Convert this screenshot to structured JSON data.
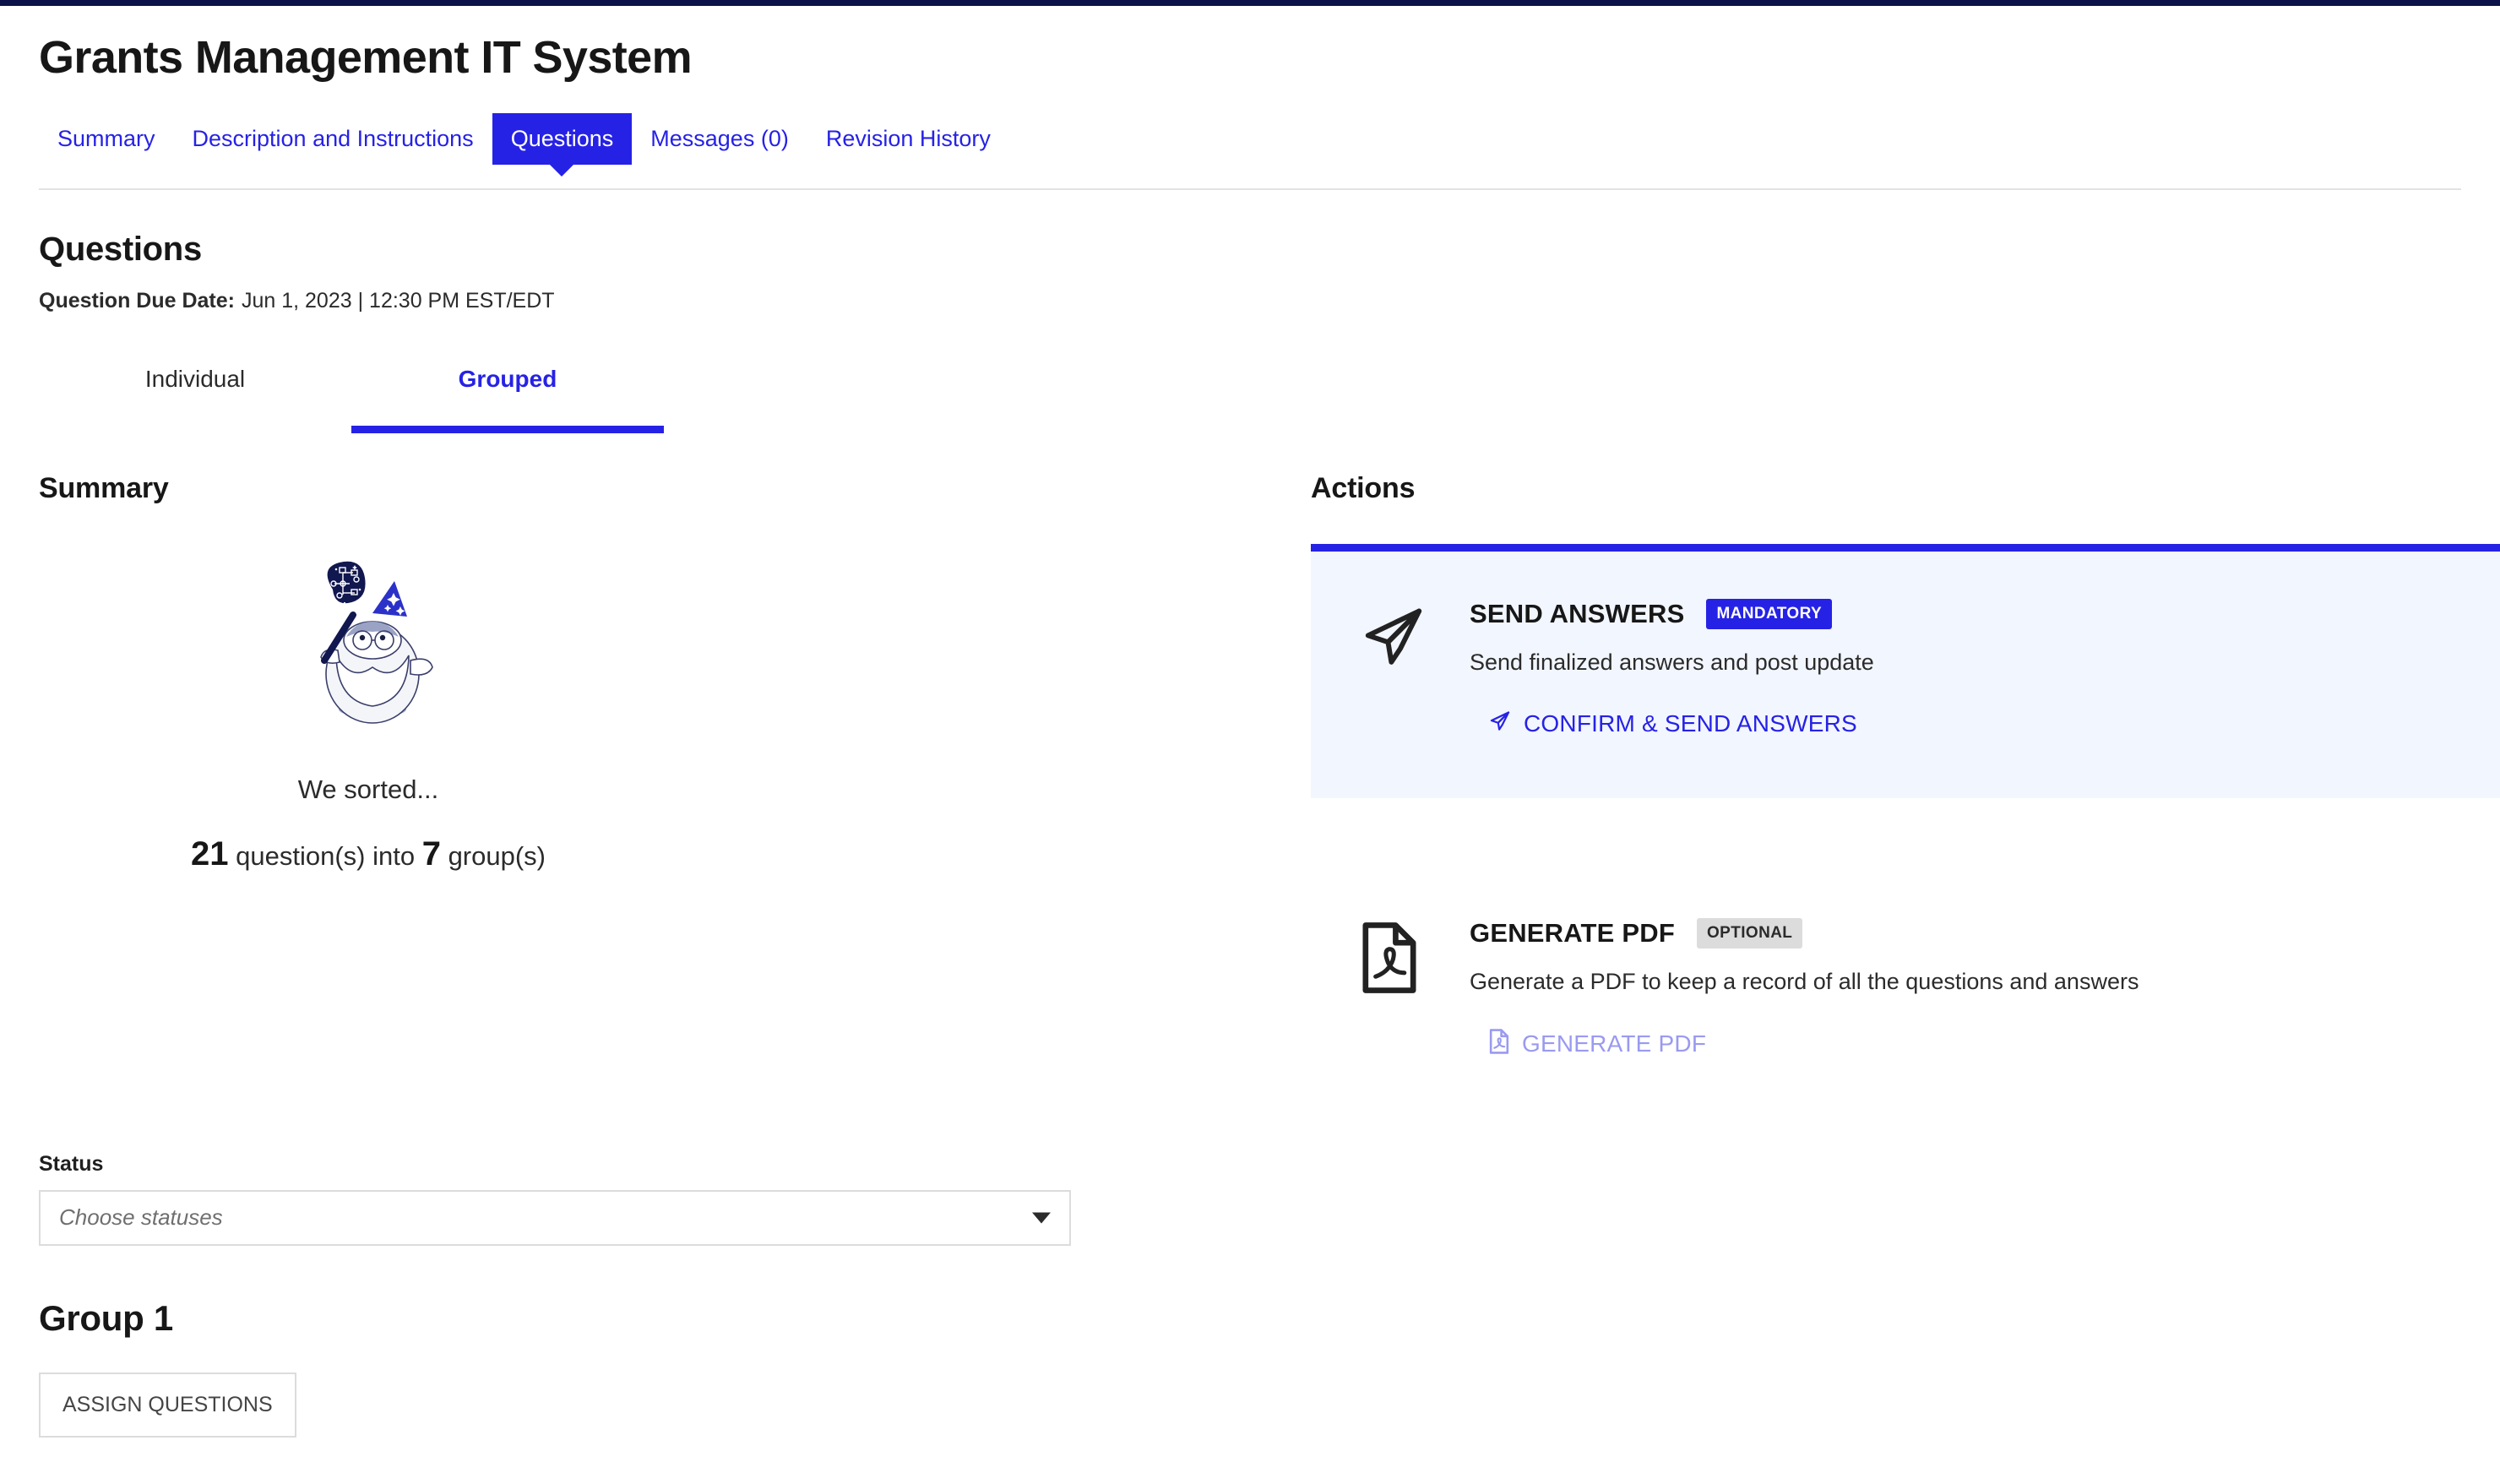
{
  "header": {
    "title": "Grants Management IT System",
    "tabs": [
      {
        "label": "Summary",
        "active": false
      },
      {
        "label": "Description and Instructions",
        "active": false
      },
      {
        "label": "Questions",
        "active": true
      },
      {
        "label": "Messages (0)",
        "active": false
      },
      {
        "label": "Revision History",
        "active": false
      }
    ]
  },
  "questions": {
    "section_title": "Questions",
    "due_label": "Question Due Date:",
    "due_value": "Jun 1, 2023 | 12:30 PM EST/EDT",
    "view_tabs": [
      {
        "label": "Individual",
        "active": false
      },
      {
        "label": "Grouped",
        "active": true
      }
    ]
  },
  "summary": {
    "heading": "Summary",
    "illustration_name": "wizard-with-wand-illustration",
    "sorted_text": "We sorted...",
    "count_questions": "21",
    "count_questions_unit": "question(s) into",
    "count_groups": "7",
    "count_groups_unit": "group(s)"
  },
  "status": {
    "label": "Status",
    "placeholder": "Choose statuses",
    "value": ""
  },
  "group": {
    "title": "Group 1",
    "assign_button": "ASSIGN QUESTIONS"
  },
  "actions": {
    "heading": "Actions",
    "cards": [
      {
        "icon": "paper-plane-icon",
        "name": "SEND ANSWERS",
        "badge": "MANDATORY",
        "badge_kind": "mandatory",
        "description": "Send finalized answers and post update",
        "link_label": "CONFIRM & SEND ANSWERS",
        "link_icon": "paper-plane-icon",
        "disabled": false
      },
      {
        "icon": "pdf-file-icon",
        "name": "GENERATE PDF",
        "badge": "OPTIONAL",
        "badge_kind": "optional",
        "description": "Generate a PDF to keep a record of all the questions and answers",
        "link_label": "GENERATE PDF",
        "link_icon": "pdf-file-icon",
        "disabled": true
      }
    ]
  },
  "colors": {
    "accent_blue": "#2622E5",
    "topbar_navy": "#0D1149",
    "card_bg": "#F2F6FE",
    "disabled_link": "#9A9AF0",
    "badge_optional_bg": "#DCDCDC"
  }
}
